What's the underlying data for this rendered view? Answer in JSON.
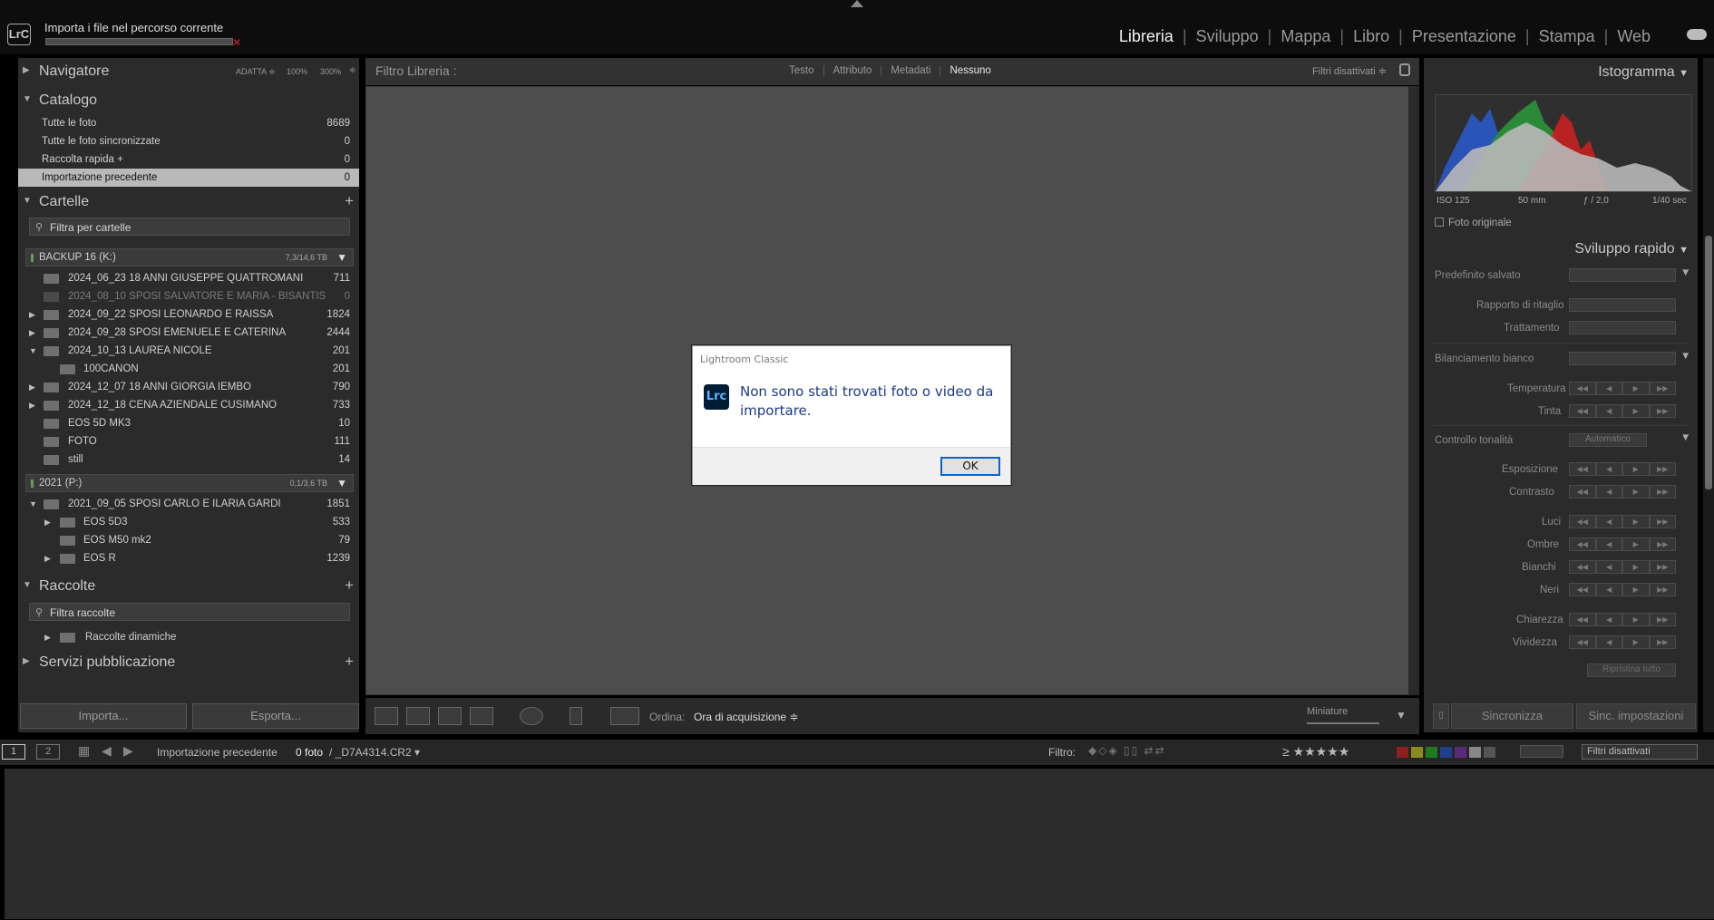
{
  "app": {
    "logo": "LrC",
    "import_status": "Importa i file nel percorso corrente",
    "import_progress": 0.0,
    "cancel_icon": "x-icon"
  },
  "modules": [
    "Libreria",
    "Sviluppo",
    "Mappa",
    "Libro",
    "Presentazione",
    "Stampa",
    "Web"
  ],
  "active_module": "Libreria",
  "left": {
    "navigator": {
      "title": "Navigatore",
      "fit": "ADATTA ≑",
      "z1": "100%",
      "z2": "300%"
    },
    "catalog": {
      "title": "Catalogo",
      "items": [
        {
          "label": "Tutte le foto",
          "count": "8689"
        },
        {
          "label": "Tutte le foto sincronizzate",
          "count": "0"
        },
        {
          "label": "Raccolta rapida +",
          "count": "0"
        },
        {
          "label": "Importazione precedente",
          "count": "0"
        }
      ]
    },
    "folders": {
      "title": "Cartelle",
      "search_placeholder": "Filtra per cartelle",
      "volume1": {
        "name": "BACKUP 16 (K:)",
        "size": "7,3/14,6 TB"
      },
      "vol1_items": [
        {
          "label": "2024_06_23 18 ANNI GIUSEPPE QUATTROMANI",
          "count": "711"
        },
        {
          "label": "2024_08_10 SPOSI SALVATORE E MARIA - BISANTIS",
          "count": "0"
        },
        {
          "label": "2024_09_22 SPOSI LEONARDO E RAISSA",
          "count": "1824"
        },
        {
          "label": "2024_09_28 SPOSI EMENUELE E CATERINA",
          "count": "2444"
        },
        {
          "label": "2024_10_13 LAUREA NICOLE",
          "count": "201"
        },
        {
          "label": "100CANON",
          "count": "201"
        },
        {
          "label": "2024_12_07 18 ANNI GIORGIA IEMBO",
          "count": "790"
        },
        {
          "label": "2024_12_18 CENA AZIENDALE CUSIMANO",
          "count": "733"
        },
        {
          "label": "EOS 5D MK3",
          "count": "10"
        },
        {
          "label": "FOTO",
          "count": "111"
        },
        {
          "label": "still",
          "count": "14"
        }
      ],
      "volume2": {
        "name": "2021 (P:)",
        "size": "0,1/3,6 TB"
      },
      "vol2_items": [
        {
          "label": "2021_09_05 SPOSI CARLO E ILARIA GARDI",
          "count": "1851"
        },
        {
          "label": "EOS 5D3",
          "count": "533"
        },
        {
          "label": "EOS M50 mk2",
          "count": "79"
        },
        {
          "label": "EOS R",
          "count": "1239"
        }
      ]
    },
    "collections": {
      "title": "Raccolte",
      "search_placeholder": "Filtra raccolte",
      "item": "Raccolte dinamiche"
    },
    "publish": {
      "title": "Servizi pubblicazione"
    },
    "import_btn": "Importa...",
    "export_btn": "Esporta..."
  },
  "center": {
    "filter_title": "Filtro Libreria :",
    "tabs": [
      "Testo",
      "Attributo",
      "Metadati",
      "Nessuno"
    ],
    "active_tab": "Nessuno",
    "filters_off": "Filtri disattivati ≑",
    "toolbar": {
      "sort_label": "Ordina:",
      "sort_value": "Ora di acquisizione ≑",
      "thumb_label": "Miniature"
    }
  },
  "dialog": {
    "title": "Lightroom Classic",
    "icon": "Lrc",
    "message": "Non sono stati trovati foto o video da importare.",
    "ok": "OK"
  },
  "right": {
    "histogram": {
      "title": "Istogramma",
      "iso": "ISO 125",
      "focal": "50 mm",
      "aperture": "ƒ / 2,0",
      "shutter": "1/40 sec",
      "original": "Foto originale"
    },
    "quick_develop": {
      "title": "Sviluppo rapido",
      "saved_preset": "Predefinito salvato",
      "crop_ratio": "Rapporto di ritaglio",
      "treatment": "Trattamento",
      "white_balance": "Bilanciamento bianco",
      "temperature": "Temperatura",
      "tint": "Tinta",
      "tone_control": "Controllo tonalità",
      "auto": "Automatico",
      "exposure": "Esposizione",
      "contrast": "Contrasto",
      "highlights": "Luci",
      "shadows": "Ombre",
      "whites": "Bianchi",
      "blacks": "Neri",
      "clarity": "Chiarezza",
      "vibrance": "Vividezza",
      "reset_all": "Ripristina tutto"
    },
    "sync_btn": "Sincronizza",
    "sync_settings_btn": "Sinc. impostazioni"
  },
  "filmbar": {
    "page1": "1",
    "page2": "2",
    "source": "Importazione precedente",
    "count": "0 foto",
    "file": "/ _D7A4314.CR2 ▾",
    "filter_label": "Filtro:",
    "filter_value": "Filtri disattivati",
    "stars": "≥ ★★★★★",
    "colors": [
      "#8a2020",
      "#8a8a20",
      "#207a20",
      "#20408a",
      "#5a2a7a",
      "#888888",
      "#555555"
    ]
  }
}
